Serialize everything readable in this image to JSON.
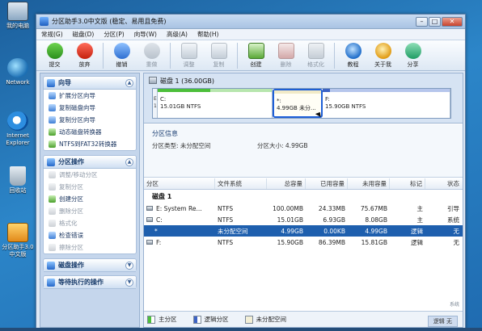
{
  "desktop": {
    "icons": [
      {
        "label": "我的电脑"
      },
      {
        "label": "Network"
      },
      {
        "label": "Internet Explorer"
      },
      {
        "label": "回收站"
      },
      {
        "label": "分区助手3.0中文版"
      }
    ]
  },
  "window": {
    "title": "分区助手3.0中文版 (稳定、易用且免费)",
    "controls": {
      "min": "–",
      "max": "□",
      "close": "✕"
    }
  },
  "menu": [
    "常规(G)",
    "磁盘(D)",
    "分区(P)",
    "向导(W)",
    "高级(A)",
    "帮助(H)"
  ],
  "toolbar": [
    {
      "label": "提交",
      "icon": "submit-icon",
      "enabled": true
    },
    {
      "label": "放弃",
      "icon": "discard-icon",
      "enabled": true
    },
    {
      "label": "撤销",
      "icon": "undo-icon",
      "enabled": true
    },
    {
      "label": "重做",
      "icon": "redo-icon",
      "enabled": false
    },
    {
      "label": "调整",
      "icon": "resize-disk-icon",
      "enabled": false
    },
    {
      "label": "复制",
      "icon": "copy-disk-icon",
      "enabled": false
    },
    {
      "label": "创建",
      "icon": "create-partition-icon",
      "enabled": true
    },
    {
      "label": "删除",
      "icon": "delete-partition-icon",
      "enabled": false
    },
    {
      "label": "格式化",
      "icon": "format-icon",
      "enabled": false
    },
    {
      "label": "教程",
      "icon": "help-icon",
      "enabled": true
    },
    {
      "label": "关于我",
      "icon": "about-icon",
      "enabled": true
    },
    {
      "label": "分享",
      "icon": "share-icon",
      "enabled": true
    }
  ],
  "sidebar": {
    "wizard": {
      "title": "向导",
      "items": [
        "扩展分区向导",
        "复制磁盘向导",
        "复制分区向导",
        "动态磁盘转换器",
        "NTFS到FAT32转换器"
      ]
    },
    "partition_ops": {
      "title": "分区操作",
      "items": [
        {
          "label": "调整/移动分区",
          "enabled": false
        },
        {
          "label": "复制分区",
          "enabled": false
        },
        {
          "label": "创建分区",
          "enabled": true
        },
        {
          "label": "删除分区",
          "enabled": false
        },
        {
          "label": "格式化",
          "enabled": false
        },
        {
          "label": "检查错误",
          "enabled": true
        },
        {
          "label": "擦除分区",
          "enabled": false
        }
      ]
    },
    "disk_ops": {
      "title": "磁盘操作"
    },
    "pending_ops": {
      "title": "等待执行的操作"
    }
  },
  "diskmap": {
    "disk_title": "磁盘 1 (36.00GB)",
    "segments": [
      {
        "id": "system",
        "line1": "E",
        "line2": "1"
      },
      {
        "id": "c",
        "line1": "C:",
        "line2": "15.01GB NTFS"
      },
      {
        "id": "unalloc",
        "line1": "*:",
        "line2": "4.99GB 未分..."
      },
      {
        "id": "f",
        "line1": "F:",
        "line2": "15.90GB NTFS"
      }
    ]
  },
  "info": {
    "title": "分区信息",
    "type_label": "分区类型: 未分配空间",
    "size_label": "分区大小: 4.99GB"
  },
  "table": {
    "columns": [
      "分区",
      "文件系统",
      "总容量",
      "已用容量",
      "未用容量",
      "标记",
      "状态"
    ],
    "group": "磁盘 1",
    "rows": [
      {
        "part": "E: System Re...",
        "fs": "NTFS",
        "cap": "100.00MB",
        "used": "24.33MB",
        "free": "75.67MB",
        "flag": "主",
        "status": "引导",
        "selected": false
      },
      {
        "part": "C:",
        "fs": "NTFS",
        "cap": "15.01GB",
        "used": "6.93GB",
        "free": "8.08GB",
        "flag": "主",
        "status": "系统",
        "selected": false
      },
      {
        "part": "*",
        "fs": "未分配空间",
        "cap": "4.99GB",
        "used": "0.00KB",
        "free": "4.99GB",
        "flag": "逻辑",
        "status": "无",
        "selected": true
      },
      {
        "part": "F:",
        "fs": "NTFS",
        "cap": "15.90GB",
        "used": "86.39MB",
        "free": "15.81GB",
        "flag": "逻辑",
        "status": "无",
        "selected": false
      }
    ]
  },
  "legend": [
    "主分区",
    "逻辑分区",
    "未分配空间"
  ],
  "watermark": {
    "line1": "系统",
    "line2": "逻辑",
    "line3": "无"
  }
}
